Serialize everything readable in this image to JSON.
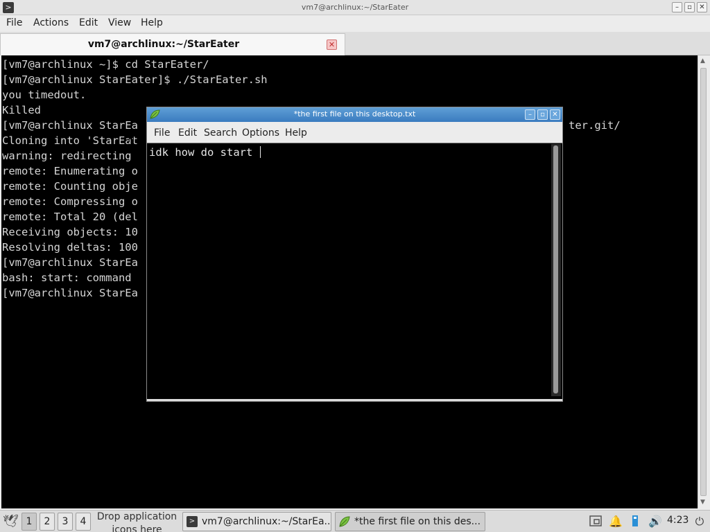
{
  "terminal": {
    "window_title": "vm7@archlinux:~/StarEater",
    "menu": [
      "File",
      "Actions",
      "Edit",
      "View",
      "Help"
    ],
    "tab_label": "vm7@archlinux:~/StarEater",
    "lines": [
      "[vm7@archlinux ~]$ cd StarEater/",
      "[vm7@archlinux StarEater]$ ./StarEater.sh",
      "you timedout.",
      "Killed",
      "[vm7@archlinux StarEa",
      "Cloning into 'StarEat",
      "warning: redirecting",
      "remote: Enumerating o",
      "remote: Counting obje",
      "remote: Compressing o",
      "remote: Total 20 (del",
      "Receiving objects: 10",
      "Resolving deltas: 100",
      "[vm7@archlinux StarEa",
      "bash: start: command",
      "[vm7@archlinux StarEa"
    ],
    "visible_tail": "ter.git/"
  },
  "editor": {
    "window_title": "*the first file on this desktop.txt",
    "menu": [
      "File",
      "Edit",
      "Search",
      "Options",
      "Help"
    ],
    "content": "idk how do start "
  },
  "taskbar": {
    "workspaces": [
      "1",
      "2",
      "3",
      "4"
    ],
    "drop_hint_line1": "Drop application",
    "drop_hint_line2": "icons here",
    "tasks": [
      {
        "label": "vm7@archlinux:~/StarEa..."
      },
      {
        "label": "*the first file on this des..."
      }
    ],
    "clock": "4:23"
  },
  "icons": {
    "terminal": "terminal-icon",
    "editor": "leafpad-icon",
    "start": "dove-icon",
    "tray": [
      "screenshot-icon",
      "notification-bell-icon",
      "usb-icon",
      "volume-icon",
      "power-icon"
    ]
  }
}
